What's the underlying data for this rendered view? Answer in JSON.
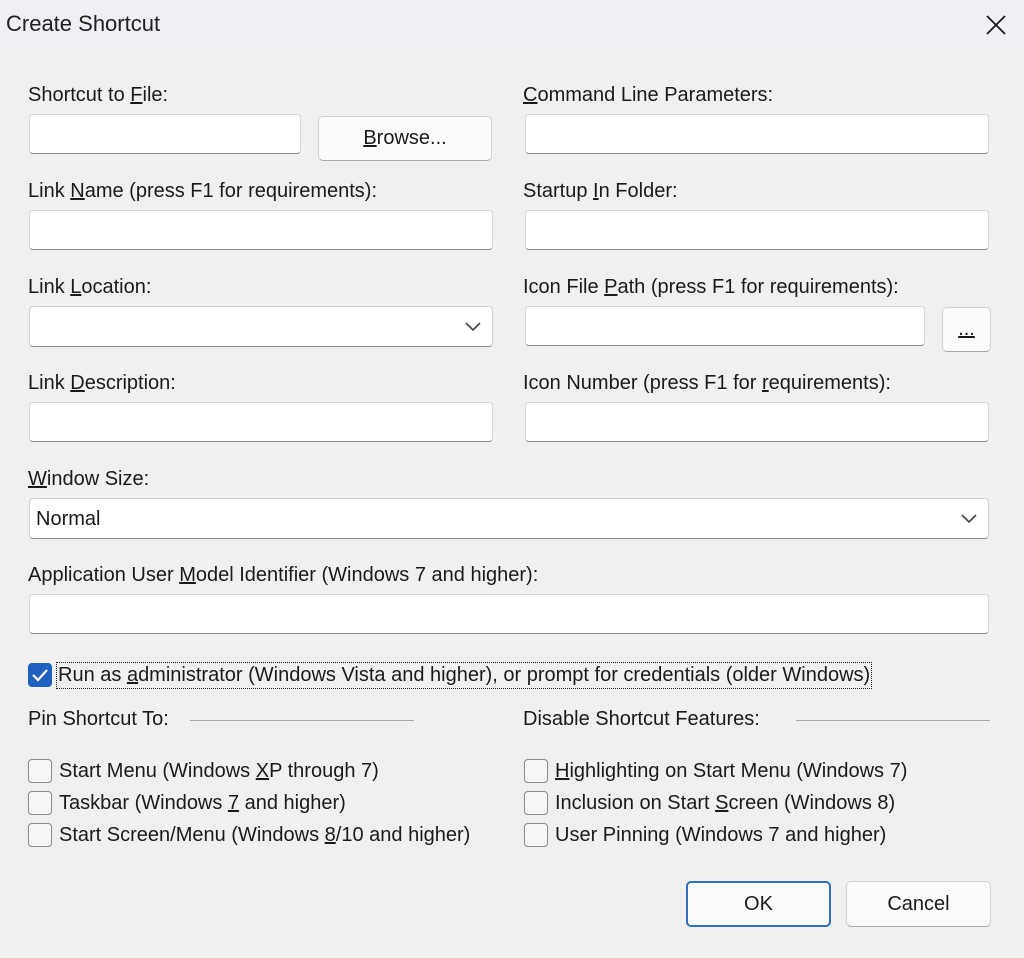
{
  "window": {
    "title": "Create Shortcut",
    "close_icon": "close-icon"
  },
  "fields": {
    "shortcut_to_file": {
      "label_pre": "Shortcut to ",
      "label_key": "F",
      "label_post": "ile:",
      "value": ""
    },
    "browse_button": {
      "pre": "",
      "key": "B",
      "post": "rowse..."
    },
    "command_line_parameters": {
      "label_pre": "",
      "label_key": "C",
      "label_post": "ommand Line Parameters:",
      "value": ""
    },
    "link_name": {
      "label_pre": "Link ",
      "label_key": "N",
      "label_post": "ame (press F1 for requirements):",
      "value": ""
    },
    "startup_in_folder": {
      "label_pre": "Startup ",
      "label_key": "I",
      "label_post": "n Folder:",
      "value": ""
    },
    "link_location": {
      "label_pre": "Link ",
      "label_key": "L",
      "label_post": "ocation:",
      "selected": ""
    },
    "icon_file_path": {
      "label_pre": "Icon File ",
      "label_key": "P",
      "label_post": "ath (press F1 for requirements):",
      "value": ""
    },
    "icon_browse_button": {
      "pre": "",
      "key": "...",
      "post": ""
    },
    "link_description": {
      "label_pre": "Link ",
      "label_key": "D",
      "label_post": "escription:",
      "value": ""
    },
    "icon_number": {
      "label_pre": "Icon Number (press F1 for ",
      "label_key": "r",
      "label_post": "equirements):",
      "value": ""
    },
    "window_size": {
      "label_pre": "",
      "label_key": "W",
      "label_post": "indow Size:",
      "selected": "Normal"
    },
    "app_user_model_id": {
      "label_pre": "Application User ",
      "label_key": "M",
      "label_post": "odel Identifier (Windows 7 and higher):",
      "value": ""
    }
  },
  "run_as_admin": {
    "checked": true,
    "label_pre": "Run as ",
    "label_key": "a",
    "label_post": "dministrator (Windows Vista and higher), or prompt for credentials (older Windows)"
  },
  "pin_group": {
    "label": "Pin Shortcut To:",
    "items": [
      {
        "pre": "Start Menu (Windows ",
        "key": "X",
        "post": "P through 7)",
        "checked": false
      },
      {
        "pre": "Taskbar (Windows ",
        "key": "7",
        "post": " and higher)",
        "checked": false
      },
      {
        "pre": "Start Screen/Menu (Windows ",
        "key": "8",
        "post": "/10 and higher)",
        "checked": false
      }
    ]
  },
  "disable_group": {
    "label": "Disable Shortcut Features:",
    "items": [
      {
        "pre": "",
        "key": "H",
        "post": "ighlighting on Start Menu (Windows 7)",
        "checked": false
      },
      {
        "pre": "Inclusion on Start ",
        "key": "S",
        "post": "creen (Windows 8)",
        "checked": false
      },
      {
        "pre": "User Pinnin",
        "key": "g",
        "post": " (Windows 7 and higher)",
        "checked": false
      }
    ]
  },
  "buttons": {
    "ok": "OK",
    "cancel": "Cancel"
  }
}
